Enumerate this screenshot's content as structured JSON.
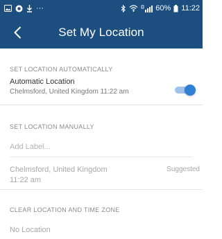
{
  "status_bar": {
    "dots": "···",
    "battery_text": "60%",
    "time": "11:22",
    "icons": [
      "image-icon",
      "whatsapp-icon",
      "download-icon",
      "bluetooth-icon",
      "wifi-icon",
      "4g-signal-icon",
      "battery-icon"
    ]
  },
  "header": {
    "title": "Set My Location",
    "back_icon": "back-arrow-icon"
  },
  "auto_section": {
    "heading": "SET LOCATION AUTOMATICALLY",
    "title": "Automatic Location",
    "subtitle": "Chelmsford, United Kingdom 11:22 am",
    "toggle_on": true
  },
  "manual_section": {
    "heading": "SET LOCATION MANUALLY",
    "label_placeholder": "Add Label...",
    "suggestion": {
      "location": "Chelmsford, United Kingdom",
      "time": "11:22 am",
      "tag": "Suggested"
    }
  },
  "clear_section": {
    "heading": "CLEAR LOCATION AND TIME ZONE",
    "option": "No Location"
  },
  "colors": {
    "brand": "#1c4f80",
    "toggle_thumb": "#2f7fd5",
    "toggle_track": "#9fc3ea"
  }
}
